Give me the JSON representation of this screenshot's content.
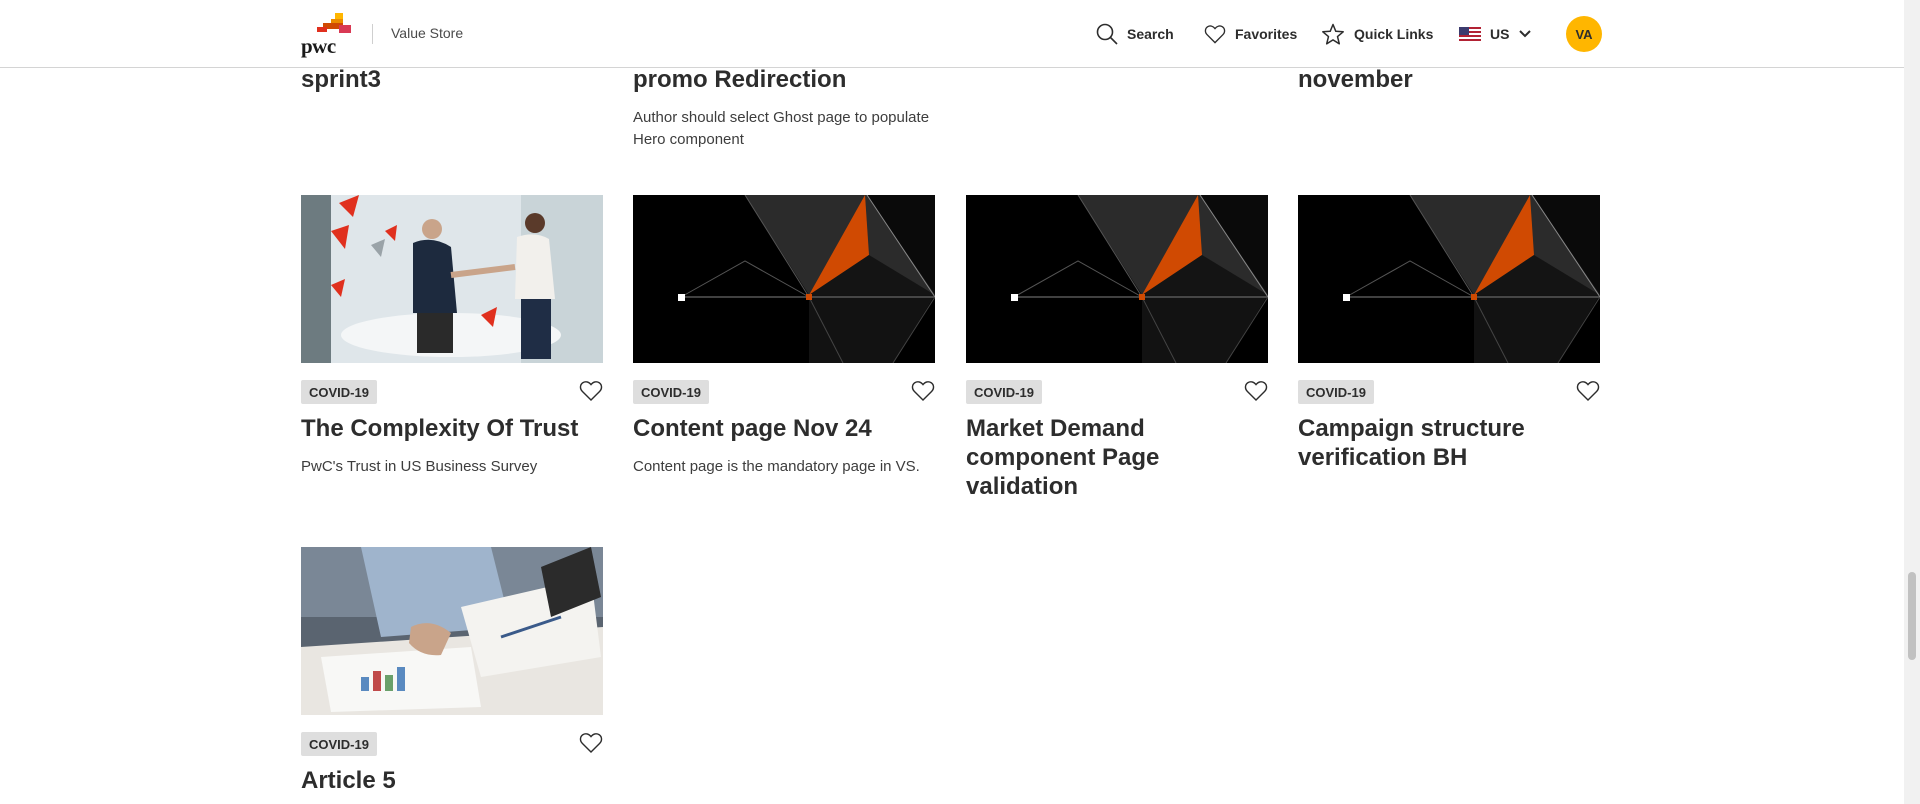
{
  "header": {
    "logo_text": "pwc",
    "app_name": "Value Store",
    "nav": {
      "search_label": "Search",
      "favorites_label": "Favorites",
      "quick_links_label": "Quick Links",
      "country_label": "US"
    },
    "avatar_initials": "VA"
  },
  "partial_row": [
    {
      "title": "sprint3",
      "desc": ""
    },
    {
      "title": "promo Redirection",
      "desc": "Author should select Ghost page to populate Hero component"
    },
    {
      "title": "",
      "desc": ""
    },
    {
      "title": "november",
      "desc": ""
    }
  ],
  "cards": [
    {
      "tag": "COVID-19",
      "title": "The Complexity Of Trust",
      "desc": "PwC's Trust in US Business Survey",
      "image": "handshake-photo"
    },
    {
      "tag": "COVID-19",
      "title": "Content page Nov 24",
      "desc": "Content page is the mandatory page in VS.",
      "image": "geometric-placeholder"
    },
    {
      "tag": "COVID-19",
      "title": "Market Demand component Page validation",
      "desc": "",
      "image": "geometric-placeholder"
    },
    {
      "tag": "COVID-19",
      "title": "Campaign structure verification BH",
      "desc": "",
      "image": "geometric-placeholder"
    },
    {
      "tag": "COVID-19",
      "title": "Article 5",
      "desc": "",
      "image": "documents-photo"
    }
  ],
  "colors": {
    "brand_orange": "#d04a02",
    "brand_yellow": "#ffb600",
    "brand_red": "#e0301e",
    "tag_bg": "#dedede"
  }
}
